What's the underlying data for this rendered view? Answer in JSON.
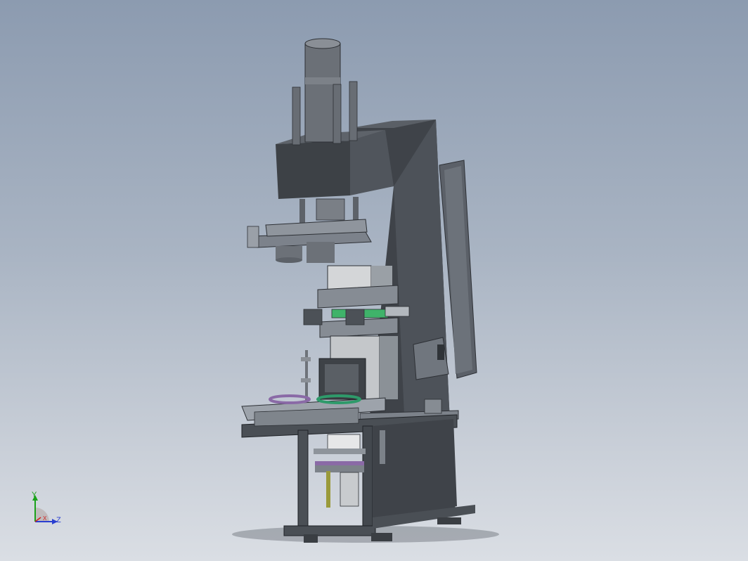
{
  "viewport": {
    "background_top": "#8c9bb0",
    "background_bottom": "#dadee4",
    "model_colors": {
      "frame": "#4a4f55",
      "frame_dark": "#3a3e43",
      "plate": "#8c919a",
      "cylinder": "#6b7077",
      "purple_ring": "#8a6aa6",
      "green_ring": "#2e9a6a",
      "green_slide": "#3fb36a",
      "olive_rod": "#9a9a3a"
    }
  },
  "triad": {
    "y_label": "Y",
    "z_label": "Z",
    "x_label": "X",
    "y_color": "#1aa21a",
    "z_color": "#2a3fd0",
    "x_color": "#d02020"
  }
}
